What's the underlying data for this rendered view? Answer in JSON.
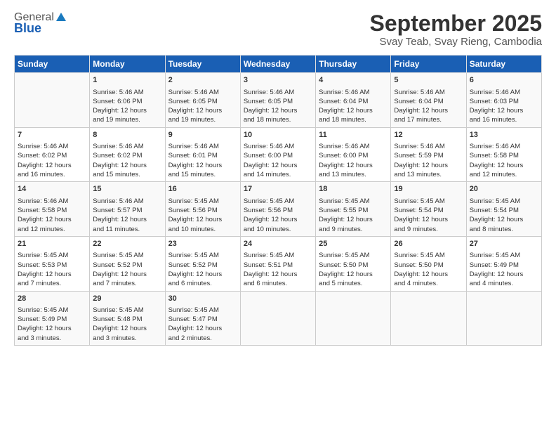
{
  "header": {
    "logo_general": "General",
    "logo_blue": "Blue",
    "title": "September 2025",
    "subtitle": "Svay Teab, Svay Rieng, Cambodia"
  },
  "calendar": {
    "days_of_week": [
      "Sunday",
      "Monday",
      "Tuesday",
      "Wednesday",
      "Thursday",
      "Friday",
      "Saturday"
    ],
    "weeks": [
      [
        {
          "day": "",
          "lines": []
        },
        {
          "day": "1",
          "lines": [
            "Sunrise: 5:46 AM",
            "Sunset: 6:06 PM",
            "Daylight: 12 hours",
            "and 19 minutes."
          ]
        },
        {
          "day": "2",
          "lines": [
            "Sunrise: 5:46 AM",
            "Sunset: 6:05 PM",
            "Daylight: 12 hours",
            "and 19 minutes."
          ]
        },
        {
          "day": "3",
          "lines": [
            "Sunrise: 5:46 AM",
            "Sunset: 6:05 PM",
            "Daylight: 12 hours",
            "and 18 minutes."
          ]
        },
        {
          "day": "4",
          "lines": [
            "Sunrise: 5:46 AM",
            "Sunset: 6:04 PM",
            "Daylight: 12 hours",
            "and 18 minutes."
          ]
        },
        {
          "day": "5",
          "lines": [
            "Sunrise: 5:46 AM",
            "Sunset: 6:04 PM",
            "Daylight: 12 hours",
            "and 17 minutes."
          ]
        },
        {
          "day": "6",
          "lines": [
            "Sunrise: 5:46 AM",
            "Sunset: 6:03 PM",
            "Daylight: 12 hours",
            "and 16 minutes."
          ]
        }
      ],
      [
        {
          "day": "7",
          "lines": [
            "Sunrise: 5:46 AM",
            "Sunset: 6:02 PM",
            "Daylight: 12 hours",
            "and 16 minutes."
          ]
        },
        {
          "day": "8",
          "lines": [
            "Sunrise: 5:46 AM",
            "Sunset: 6:02 PM",
            "Daylight: 12 hours",
            "and 15 minutes."
          ]
        },
        {
          "day": "9",
          "lines": [
            "Sunrise: 5:46 AM",
            "Sunset: 6:01 PM",
            "Daylight: 12 hours",
            "and 15 minutes."
          ]
        },
        {
          "day": "10",
          "lines": [
            "Sunrise: 5:46 AM",
            "Sunset: 6:00 PM",
            "Daylight: 12 hours",
            "and 14 minutes."
          ]
        },
        {
          "day": "11",
          "lines": [
            "Sunrise: 5:46 AM",
            "Sunset: 6:00 PM",
            "Daylight: 12 hours",
            "and 13 minutes."
          ]
        },
        {
          "day": "12",
          "lines": [
            "Sunrise: 5:46 AM",
            "Sunset: 5:59 PM",
            "Daylight: 12 hours",
            "and 13 minutes."
          ]
        },
        {
          "day": "13",
          "lines": [
            "Sunrise: 5:46 AM",
            "Sunset: 5:58 PM",
            "Daylight: 12 hours",
            "and 12 minutes."
          ]
        }
      ],
      [
        {
          "day": "14",
          "lines": [
            "Sunrise: 5:46 AM",
            "Sunset: 5:58 PM",
            "Daylight: 12 hours",
            "and 12 minutes."
          ]
        },
        {
          "day": "15",
          "lines": [
            "Sunrise: 5:46 AM",
            "Sunset: 5:57 PM",
            "Daylight: 12 hours",
            "and 11 minutes."
          ]
        },
        {
          "day": "16",
          "lines": [
            "Sunrise: 5:45 AM",
            "Sunset: 5:56 PM",
            "Daylight: 12 hours",
            "and 10 minutes."
          ]
        },
        {
          "day": "17",
          "lines": [
            "Sunrise: 5:45 AM",
            "Sunset: 5:56 PM",
            "Daylight: 12 hours",
            "and 10 minutes."
          ]
        },
        {
          "day": "18",
          "lines": [
            "Sunrise: 5:45 AM",
            "Sunset: 5:55 PM",
            "Daylight: 12 hours",
            "and 9 minutes."
          ]
        },
        {
          "day": "19",
          "lines": [
            "Sunrise: 5:45 AM",
            "Sunset: 5:54 PM",
            "Daylight: 12 hours",
            "and 9 minutes."
          ]
        },
        {
          "day": "20",
          "lines": [
            "Sunrise: 5:45 AM",
            "Sunset: 5:54 PM",
            "Daylight: 12 hours",
            "and 8 minutes."
          ]
        }
      ],
      [
        {
          "day": "21",
          "lines": [
            "Sunrise: 5:45 AM",
            "Sunset: 5:53 PM",
            "Daylight: 12 hours",
            "and 7 minutes."
          ]
        },
        {
          "day": "22",
          "lines": [
            "Sunrise: 5:45 AM",
            "Sunset: 5:52 PM",
            "Daylight: 12 hours",
            "and 7 minutes."
          ]
        },
        {
          "day": "23",
          "lines": [
            "Sunrise: 5:45 AM",
            "Sunset: 5:52 PM",
            "Daylight: 12 hours",
            "and 6 minutes."
          ]
        },
        {
          "day": "24",
          "lines": [
            "Sunrise: 5:45 AM",
            "Sunset: 5:51 PM",
            "Daylight: 12 hours",
            "and 6 minutes."
          ]
        },
        {
          "day": "25",
          "lines": [
            "Sunrise: 5:45 AM",
            "Sunset: 5:50 PM",
            "Daylight: 12 hours",
            "and 5 minutes."
          ]
        },
        {
          "day": "26",
          "lines": [
            "Sunrise: 5:45 AM",
            "Sunset: 5:50 PM",
            "Daylight: 12 hours",
            "and 4 minutes."
          ]
        },
        {
          "day": "27",
          "lines": [
            "Sunrise: 5:45 AM",
            "Sunset: 5:49 PM",
            "Daylight: 12 hours",
            "and 4 minutes."
          ]
        }
      ],
      [
        {
          "day": "28",
          "lines": [
            "Sunrise: 5:45 AM",
            "Sunset: 5:49 PM",
            "Daylight: 12 hours",
            "and 3 minutes."
          ]
        },
        {
          "day": "29",
          "lines": [
            "Sunrise: 5:45 AM",
            "Sunset: 5:48 PM",
            "Daylight: 12 hours",
            "and 3 minutes."
          ]
        },
        {
          "day": "30",
          "lines": [
            "Sunrise: 5:45 AM",
            "Sunset: 5:47 PM",
            "Daylight: 12 hours",
            "and 2 minutes."
          ]
        },
        {
          "day": "",
          "lines": []
        },
        {
          "day": "",
          "lines": []
        },
        {
          "day": "",
          "lines": []
        },
        {
          "day": "",
          "lines": []
        }
      ]
    ]
  }
}
